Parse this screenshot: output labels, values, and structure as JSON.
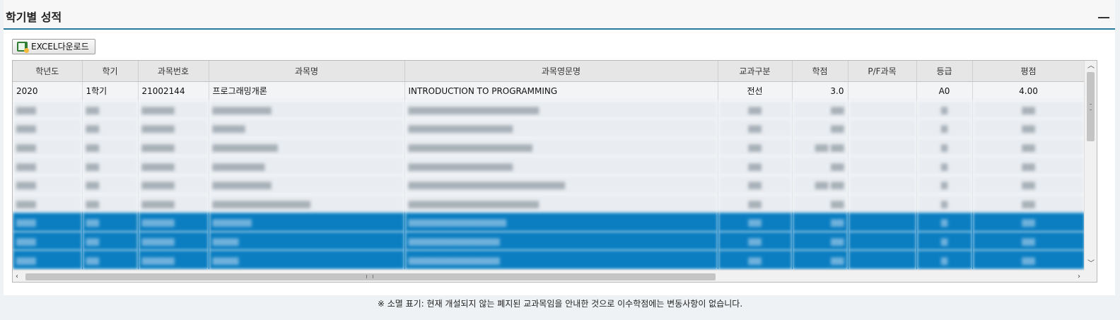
{
  "panel": {
    "title": "학기별 성적"
  },
  "toolbar": {
    "excel_label": "EXCEL다운로드"
  },
  "grid": {
    "columns": [
      "학년도",
      "학기",
      "과목번호",
      "과목명",
      "과목영문명",
      "교과구분",
      "학점",
      "P/F과목",
      "등급",
      "평점"
    ],
    "first_row": {
      "year": "2020",
      "term": "1학기",
      "course_no": "21002144",
      "course_name": "프로그래밍개론",
      "course_en": "INTRODUCTION TO PROGRAMMING",
      "category": "전선",
      "credit": "3.0",
      "pf": "",
      "grade": "A0",
      "gpa": "4.00"
    }
  },
  "footnote": "※ 소멸 표기: 현재 개설되지 않는 폐지된 교과목임을 안내한 것으로 이수학점에는 변동사항이 없습니다."
}
